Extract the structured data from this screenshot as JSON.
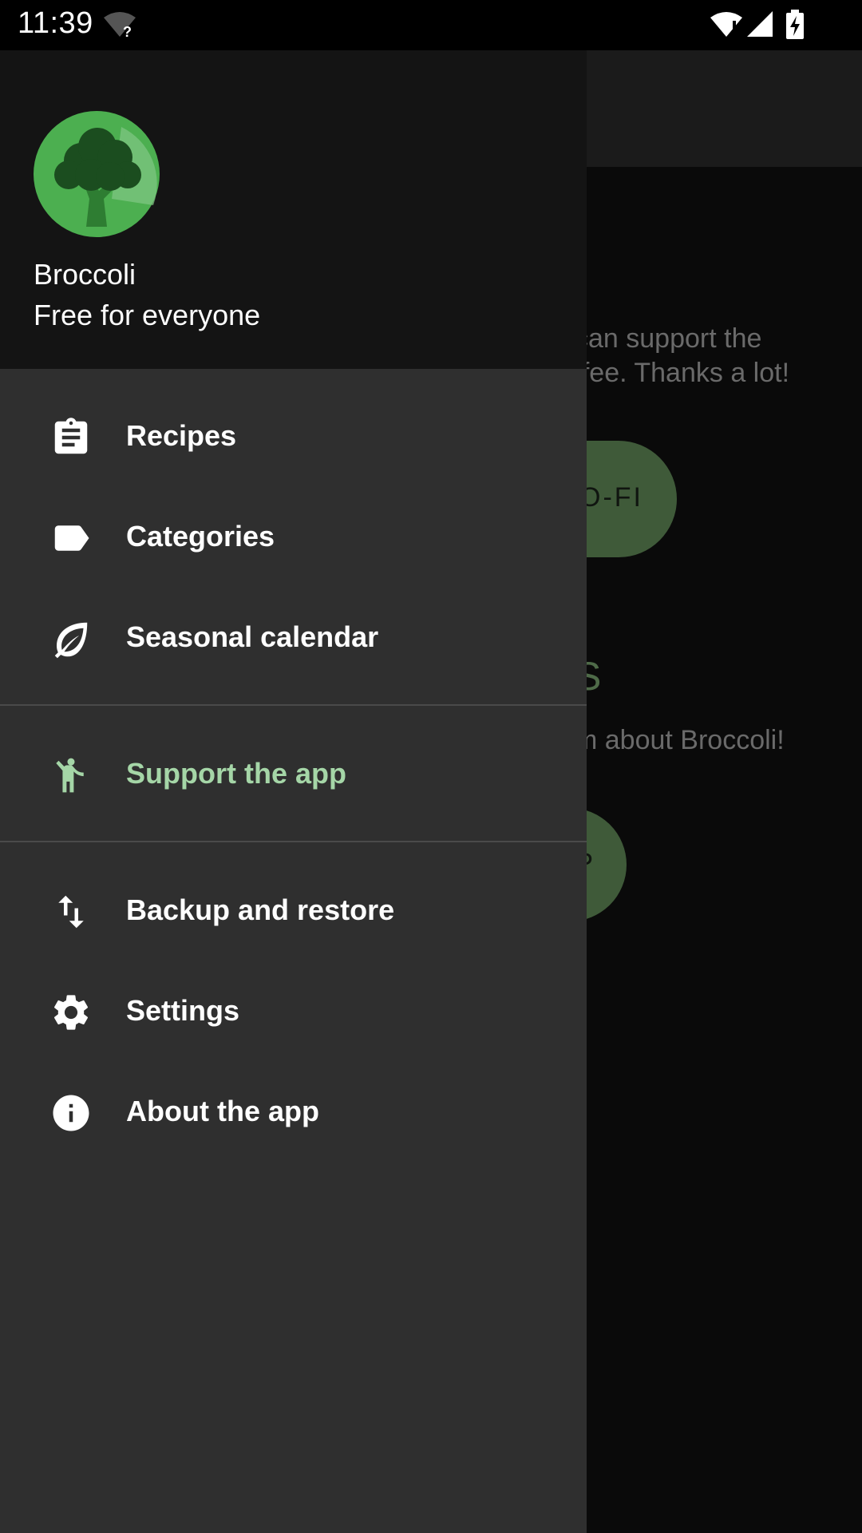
{
  "status_bar": {
    "time": "11:39",
    "icons": [
      "wifi-question-icon",
      "wifi-icon",
      "signal-icon",
      "battery-charging-icon"
    ]
  },
  "background": {
    "text_line1": "can support the",
    "text_line2": "ffee. Thanks a lot!",
    "button1_label": "O-FI",
    "heading": "S",
    "text_line3": "m about Broccoli!",
    "button2_label": "P"
  },
  "drawer": {
    "header": {
      "app_name": "Broccoli",
      "subtitle": "Free for everyone",
      "logo_icon": "broccoli-logo-icon"
    },
    "items": [
      {
        "label": "Recipes",
        "icon": "clipboard-icon"
      },
      {
        "label": "Categories",
        "icon": "label-icon"
      },
      {
        "label": "Seasonal calendar",
        "icon": "leaf-icon"
      },
      {
        "label": "Support the app",
        "icon": "person-waving-icon",
        "active": true
      },
      {
        "label": "Backup and restore",
        "icon": "swap-vertical-icon"
      },
      {
        "label": "Settings",
        "icon": "gear-icon"
      },
      {
        "label": "About the app",
        "icon": "info-icon"
      }
    ]
  },
  "colors": {
    "accent": "#a5d6a7",
    "drawer_bg": "#2f2f2f",
    "header_bg": "#141414",
    "logo_green": "#4caf50"
  }
}
